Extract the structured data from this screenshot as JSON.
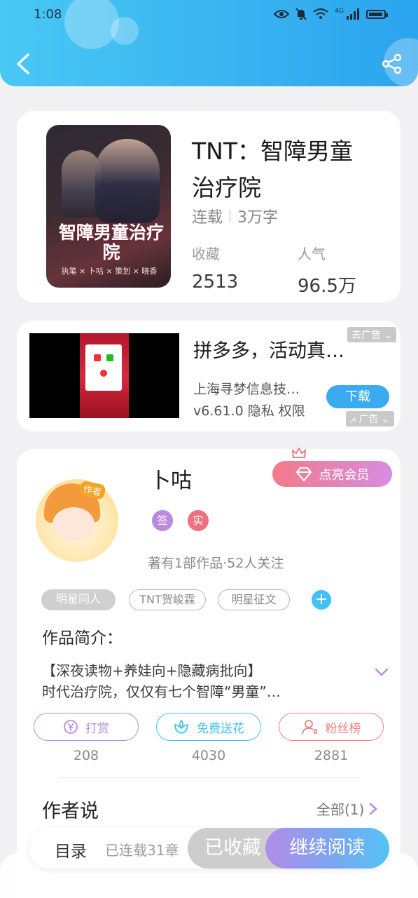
{
  "status_bar": {
    "time": "1:08",
    "network": "4G"
  },
  "colors": {
    "header": "#38b2f0",
    "accent_blue": "#3aaaf1",
    "tag_add": "#41c2f2",
    "vip_start": "#f37a8a",
    "vip_end": "#d68de0",
    "continue_start": "#b38ce9",
    "continue_end": "#53c4f4"
  },
  "header": {
    "back_icon": "chevron-left-icon",
    "share_icon": "share-icon"
  },
  "book": {
    "title": "TNT：智障男童治疗院",
    "status": "连载",
    "word_count": "3万字",
    "stats": [
      {
        "label": "收藏",
        "value": "2513"
      },
      {
        "label": "人气",
        "value": "96.5万"
      }
    ],
    "cover": {
      "title": "智障男童治疗院",
      "credits": "执笔 × 卜咕 × 策划 × 晓香"
    }
  },
  "ad": {
    "title": "拼多多，活动真…",
    "company": "上海寻梦信息技…",
    "version": "v6.61.0 隐私 权限",
    "close_tag": "去广告",
    "ad_tag": "广告",
    "download_label": "下载"
  },
  "author": {
    "name": "卜咕",
    "avatar_badge": "作者",
    "vip_label": "点亮会员",
    "badges": [
      {
        "label": "签",
        "color": "#b98ae0"
      },
      {
        "label": "实",
        "color": "#f0717e"
      }
    ],
    "summary": "著有1部作品·52人关注",
    "tags": [
      "明星同人",
      "TNT贺峻霖",
      "明星征文"
    ],
    "intro": {
      "heading": "作品简介：",
      "line1": "【深夜读物+养娃向+隐藏病批向】",
      "line2": "时代治疗院，仅仅有七个智障“男童”…"
    },
    "actions": [
      {
        "label": "打赏",
        "icon": "yen-coin-icon",
        "count": "208",
        "color": "#b98ae0"
      },
      {
        "label": "免费送花",
        "icon": "flower-icon",
        "count": "4030",
        "color": "#41c2f2"
      },
      {
        "label": "粉丝榜",
        "icon": "fans-ranking-icon",
        "count": "2881",
        "color": "#f08080"
      }
    ],
    "author_say": {
      "heading": "作者说",
      "all_label": "全部(1)"
    }
  },
  "bottom_bar": {
    "catalog": "目录",
    "chapters": "已连载31章",
    "collected": "已收藏",
    "continue": "继续阅读"
  }
}
